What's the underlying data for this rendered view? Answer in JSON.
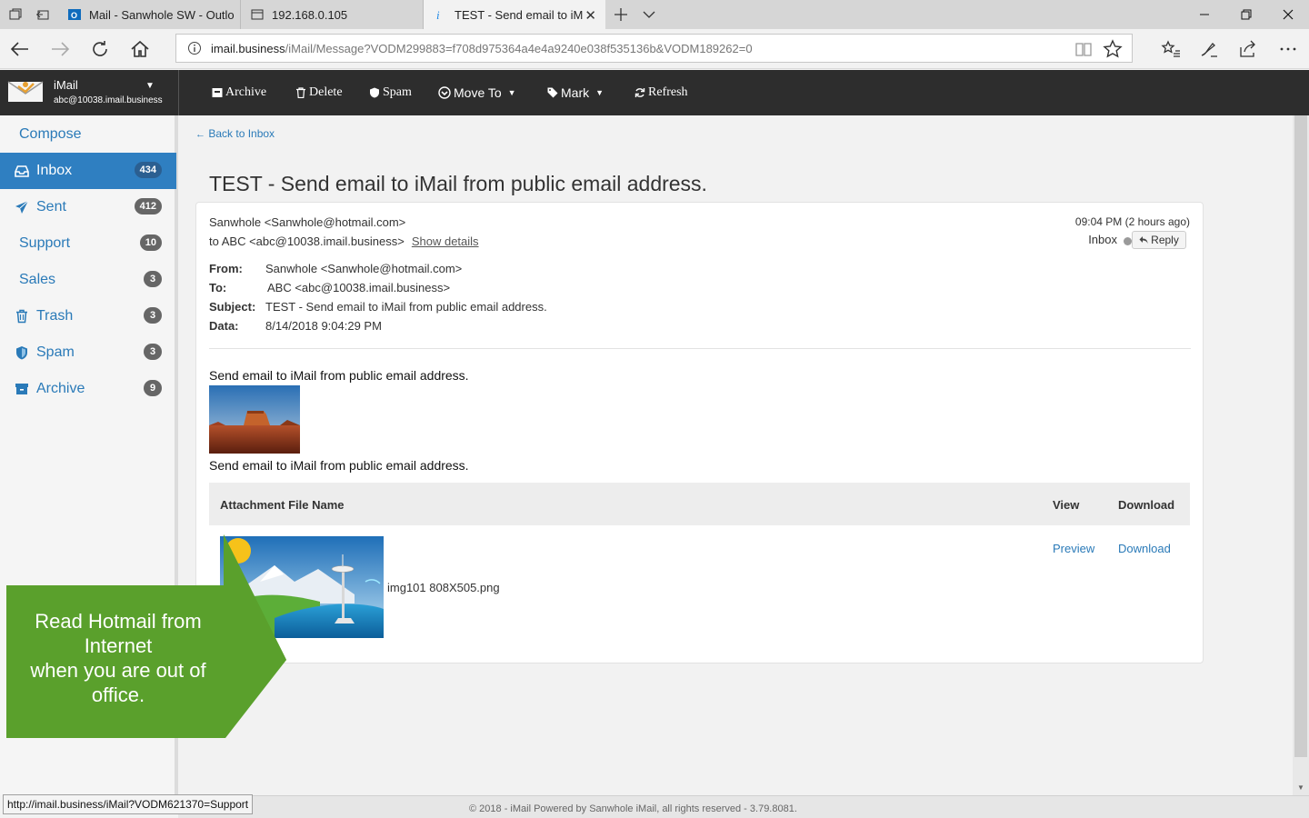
{
  "browser": {
    "tabs": [
      {
        "title": "Mail - Sanwhole SW - Outlo",
        "icon": "outlook-icon"
      },
      {
        "title": "192.168.0.105",
        "icon": "page-icon"
      },
      {
        "title": "TEST - Send email to iM",
        "icon": "edge-loading-icon"
      }
    ],
    "url_host": "imail.business",
    "url_path": "/iMail/Message?VODM299883=f708d975364a4e4a9240e038f535136b&VODM189262=0"
  },
  "app": {
    "name": "iMail",
    "account": "abc@10038.imail.business",
    "toolbar": {
      "archive": "Archive",
      "delete": "Delete",
      "spam": "Spam",
      "move_to": "Move To",
      "mark": "Mark",
      "refresh": "Refresh"
    }
  },
  "sidebar": {
    "items": [
      {
        "label": "Compose",
        "count": null,
        "icon": null
      },
      {
        "label": "Inbox",
        "count": "434",
        "icon": "inbox-icon"
      },
      {
        "label": "Sent",
        "count": "412",
        "icon": "paper-plane-icon"
      },
      {
        "label": "Support",
        "count": "10",
        "icon": null
      },
      {
        "label": "Sales",
        "count": "3",
        "icon": null
      },
      {
        "label": "Trash",
        "count": "3",
        "icon": "trash-icon"
      },
      {
        "label": "Spam",
        "count": "3",
        "icon": "shield-icon"
      },
      {
        "label": "Archive",
        "count": "9",
        "icon": "archive-box-icon"
      }
    ]
  },
  "message": {
    "back_link": "Back to Inbox",
    "title": "TEST - Send email to iMail from public email address.",
    "sender_line": "Sanwhole <Sanwhole@hotmail.com>",
    "to_line": "to ABC <abc@10038.imail.business>",
    "show_details": "Show details",
    "time": "09:04 PM (2 hours ago)",
    "folder": "Inbox",
    "reply": "Reply",
    "headers": {
      "from_label": "From:",
      "from_value": "Sanwhole <Sanwhole@hotmail.com>",
      "to_label": "To:",
      "to_value": "ABC <abc@10038.imail.business>",
      "subject_label": "Subject:",
      "subject_value": "TEST - Send email to iMail from public email address.",
      "date_label": "Data:",
      "date_value": "8/14/2018 9:04:29 PM"
    },
    "body_line_1": "Send email to iMail from public email address.",
    "body_line_2": "Send email to iMail from public email address."
  },
  "attachments": {
    "col_name": "Attachment File Name",
    "col_view": "View",
    "col_download": "Download",
    "rows": [
      {
        "file_name": "img101 808X505.png",
        "view": "Preview",
        "download": "Download"
      }
    ]
  },
  "footer": "© 2018 - iMail Powered by Sanwhole iMail, all rights reserved - 3.79.8081.",
  "status_url": "http://imail.business/iMail?VODM621370=Support",
  "callout": {
    "line_1": "Read Hotmail from Internet",
    "line_2": "when you are out of office.",
    "color": "#5aa02c"
  },
  "colors": {
    "accent": "#2f7fc1",
    "link": "#2a7ab8",
    "appbar": "#2d2d2d"
  }
}
